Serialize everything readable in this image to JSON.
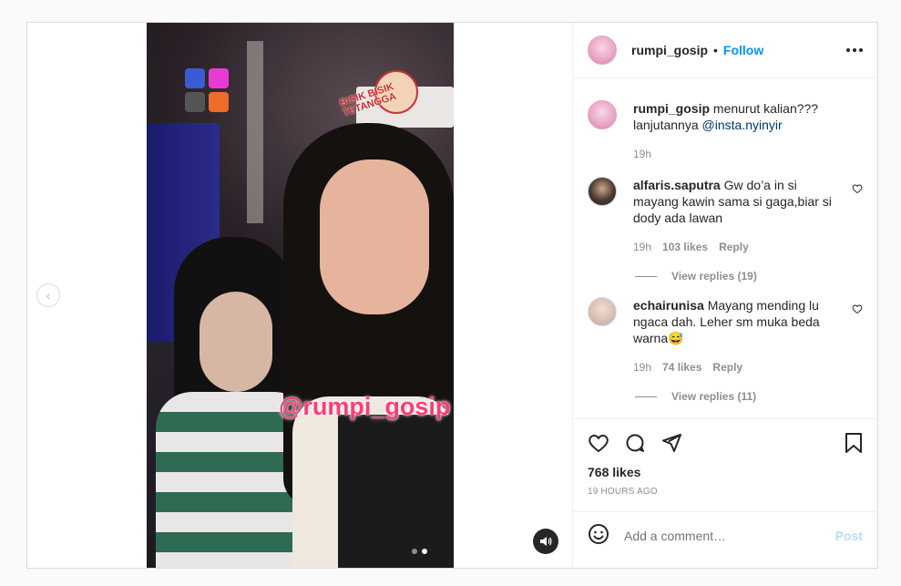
{
  "post": {
    "author": "rumpi_gosip",
    "separator": "•",
    "follow_label": "Follow",
    "video_watermark": "@rumpi_gosip",
    "video_badge": "BISIK BISIK TETANGGA",
    "carousel_total": 2,
    "carousel_current": 2
  },
  "caption": {
    "username": "rumpi_gosip",
    "text_before": "menurut kalian??? lanjutannya ",
    "mention": "@insta.nyinyir",
    "time": "19h"
  },
  "comments": [
    {
      "username": "alfaris.saputra",
      "text": "Gw do’a in si mayang kawin sama si gaga,biar si dody ada lawan",
      "time": "19h",
      "likes": "103 likes",
      "reply_label": "Reply",
      "view_replies": "View replies (19)"
    },
    {
      "username": "echairunisa",
      "text": "Mayang mending lu ngaca dah. Leher sm muka beda warna😅",
      "time": "19h",
      "likes": "74 likes",
      "reply_label": "Reply",
      "view_replies": "View replies (11)"
    }
  ],
  "actions": {
    "likes": "768 likes",
    "timestamp": "19 HOURS AGO"
  },
  "add_comment": {
    "placeholder": "Add a comment…",
    "post_label": "Post"
  },
  "colors": {
    "accent": "#0095f6",
    "post_disabled": "#b2dffc",
    "watermark": "#ff3b7a"
  }
}
